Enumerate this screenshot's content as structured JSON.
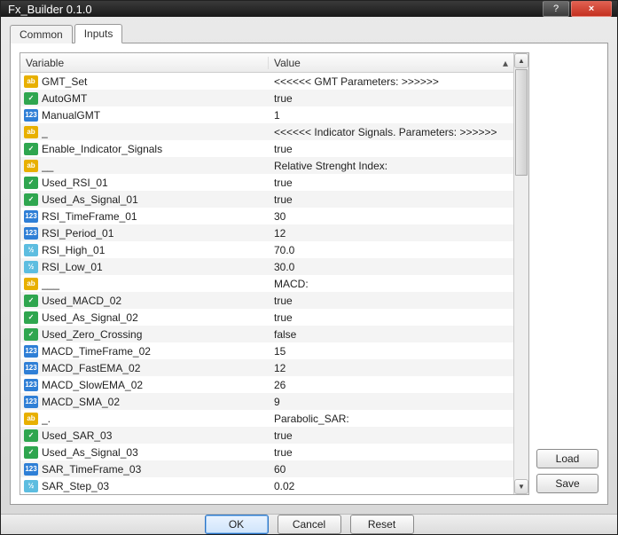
{
  "window": {
    "title": "Fx_Builder 0.1.0"
  },
  "tabs": {
    "common": "Common",
    "inputs": "Inputs"
  },
  "grid": {
    "header_variable": "Variable",
    "header_value": "Value",
    "rows": [
      {
        "type": "ab",
        "name": "GMT_Set",
        "value": "<<<<<< GMT Parameters: >>>>>>"
      },
      {
        "type": "bool",
        "name": "AutoGMT",
        "value": "true"
      },
      {
        "type": "int",
        "name": "ManualGMT",
        "value": "1"
      },
      {
        "type": "ab",
        "name": "_",
        "value": "<<<<<< Indicator Signals. Parameters: >>>>>>"
      },
      {
        "type": "bool",
        "name": "Enable_Indicator_Signals",
        "value": "true"
      },
      {
        "type": "ab",
        "name": "__",
        "value": "Relative Strenght Index:"
      },
      {
        "type": "bool",
        "name": "Used_RSI_01",
        "value": "true"
      },
      {
        "type": "bool",
        "name": "Used_As_Signal_01",
        "value": "true"
      },
      {
        "type": "int",
        "name": "RSI_TimeFrame_01",
        "value": "30"
      },
      {
        "type": "int",
        "name": "RSI_Period_01",
        "value": "12"
      },
      {
        "type": "dbl",
        "name": "RSI_High_01",
        "value": "70.0"
      },
      {
        "type": "dbl",
        "name": "RSI_Low_01",
        "value": "30.0"
      },
      {
        "type": "ab",
        "name": "___",
        "value": "MACD:"
      },
      {
        "type": "bool",
        "name": "Used_MACD_02",
        "value": "true"
      },
      {
        "type": "bool",
        "name": "Used_As_Signal_02",
        "value": "true"
      },
      {
        "type": "bool",
        "name": "Used_Zero_Crossing",
        "value": "false"
      },
      {
        "type": "int",
        "name": "MACD_TimeFrame_02",
        "value": "15"
      },
      {
        "type": "int",
        "name": "MACD_FastEMA_02",
        "value": "12"
      },
      {
        "type": "int",
        "name": "MACD_SlowEMA_02",
        "value": "26"
      },
      {
        "type": "int",
        "name": "MACD_SMA_02",
        "value": "9"
      },
      {
        "type": "ab",
        "name": "_.",
        "value": "Parabolic_SAR:"
      },
      {
        "type": "bool",
        "name": "Used_SAR_03",
        "value": "true"
      },
      {
        "type": "bool",
        "name": "Used_As_Signal_03",
        "value": "true"
      },
      {
        "type": "int",
        "name": "SAR_TimeFrame_03",
        "value": "60"
      },
      {
        "type": "dbl",
        "name": "SAR_Step_03",
        "value": "0.02"
      }
    ]
  },
  "buttons": {
    "load": "Load",
    "save": "Save",
    "ok": "OK",
    "cancel": "Cancel",
    "reset": "Reset"
  },
  "icons": {
    "ab": "ab",
    "bool": "✓",
    "int": "123",
    "dbl": "½"
  }
}
